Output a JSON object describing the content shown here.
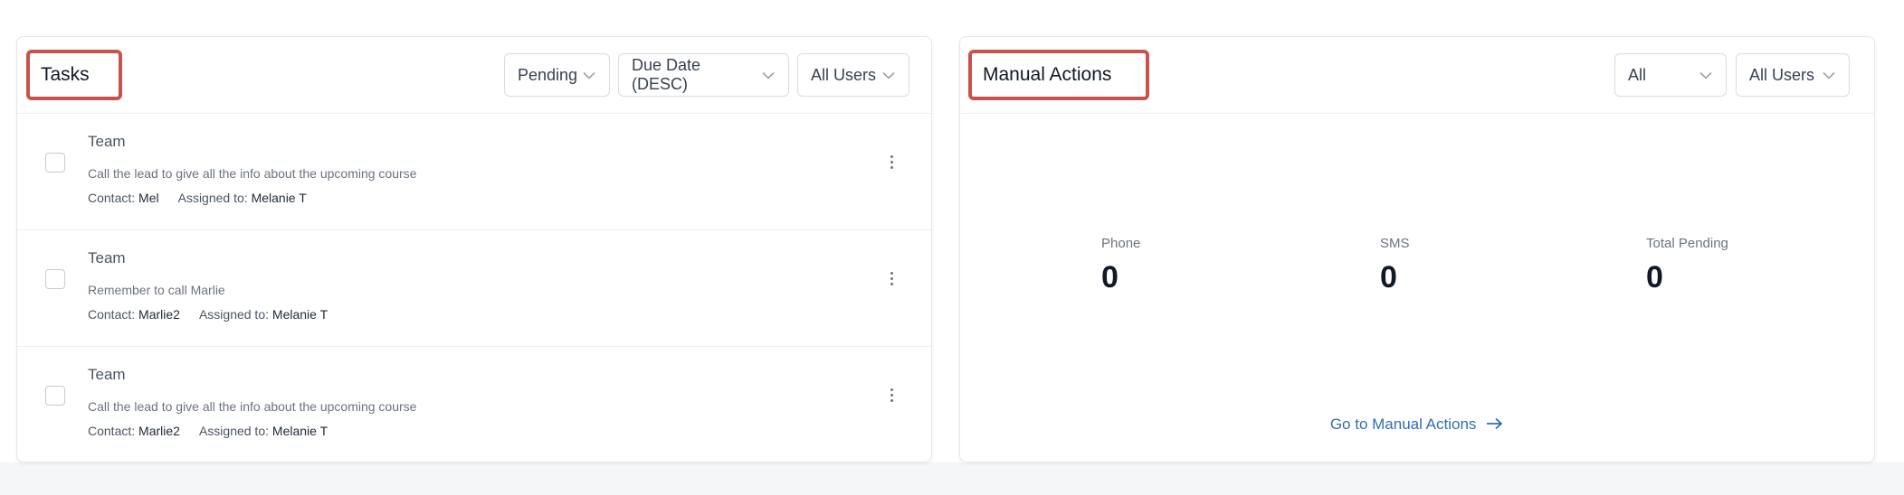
{
  "tasks_panel": {
    "title": "Tasks",
    "filters": {
      "status": "Pending",
      "sort": "Due Date (DESC)",
      "users": "All Users"
    },
    "contact_label": "Contact:",
    "assigned_label": "Assigned to:",
    "items": [
      {
        "title": "Team",
        "description": "Call the lead to give all the info about the upcoming course",
        "contact": "Mel",
        "assigned_to": "Melanie T"
      },
      {
        "title": "Team",
        "description": "Remember to call Marlie",
        "contact": "Marlie2",
        "assigned_to": "Melanie T"
      },
      {
        "title": "Team",
        "description": "Call the lead to give all the info about the upcoming course",
        "contact": "Marlie2",
        "assigned_to": "Melanie T"
      }
    ]
  },
  "manual_actions_panel": {
    "title": "Manual Actions",
    "filters": {
      "type": "All",
      "users": "All Users"
    },
    "stats": [
      {
        "label": "Phone",
        "value": "0"
      },
      {
        "label": "SMS",
        "value": "0"
      },
      {
        "label": "Total Pending",
        "value": "0"
      }
    ],
    "link": "Go to Manual Actions"
  },
  "theme": {
    "highlight_border": "#c9534a",
    "link_color": "#2f6fb3"
  },
  "icons": [
    "chevron-down-icon",
    "kebab-menu-icon",
    "arrow-right-icon"
  ]
}
